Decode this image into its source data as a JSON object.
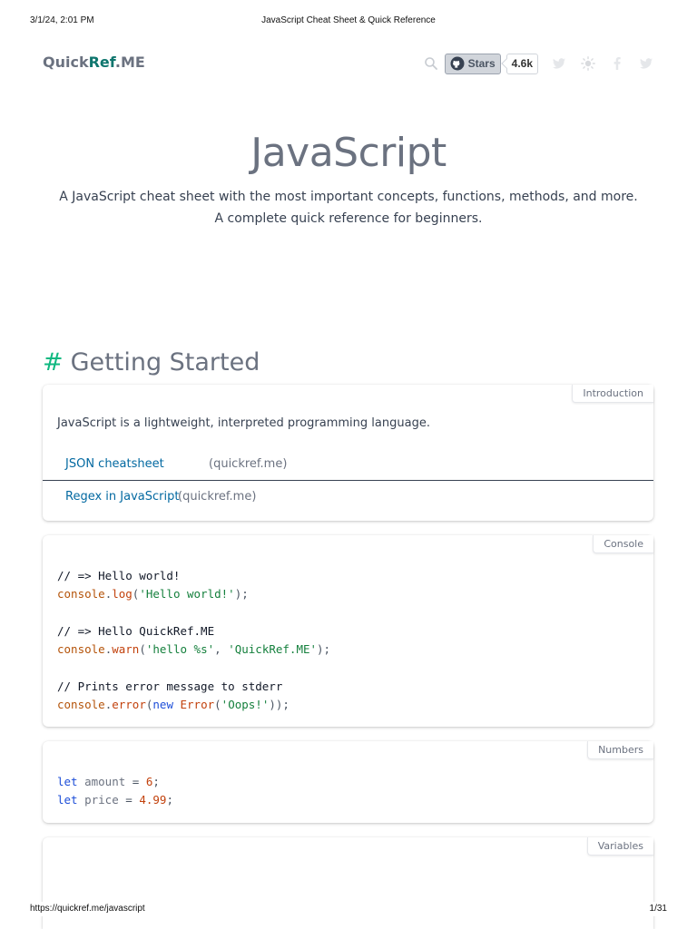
{
  "print_header": {
    "date": "3/1/24, 2:01 PM",
    "title": "JavaScript Cheat Sheet & Quick Reference"
  },
  "print_footer": {
    "url": "https://quickref.me/javascript",
    "page": "1/31"
  },
  "navbar": {
    "logo": {
      "quick": "Quick",
      "ref": "Ref",
      "me": ".ME"
    },
    "icons": [
      "search-icon",
      "github-icon",
      "twitter-icon",
      "sun-icon",
      "facebook-icon",
      "twitter-icon"
    ],
    "github_button_label": "Stars",
    "github_count": "4.6k"
  },
  "hero": {
    "title": "JavaScript",
    "description": "A JavaScript cheat sheet with the most important concepts, functions, methods, and more. A complete quick reference for beginners."
  },
  "section": {
    "hash": "#",
    "title": "Getting Started"
  },
  "cards": {
    "introduction": {
      "label": "Introduction",
      "text": "JavaScript is a lightweight, interpreted programming language.",
      "links": [
        {
          "text": "JSON cheatsheet",
          "source": "(quickref.me)"
        },
        {
          "text": "Regex in JavaScript",
          "source": "(quickref.me)"
        }
      ]
    },
    "console": {
      "label": "Console",
      "code": {
        "c1": "// => Hello world!",
        "obj": "console",
        "dot": ".",
        "log": "log",
        "paren_open": "(",
        "str_hello_world": "'Hello world!'",
        "close_semi": ");",
        "c2": "// => Hello QuickRef.ME",
        "warn": "warn",
        "str_hello_s": "'hello %s'",
        "comma": ", ",
        "str_quickref": "'QuickRef.ME'",
        "c3": "// Prints error message to stderr",
        "error": "error",
        "kw_new": "new",
        "space": " ",
        "cls_error": "Error",
        "str_oops": "'Oops!'",
        "close_close_semi": "));"
      }
    },
    "numbers": {
      "label": "Numbers",
      "code": {
        "kw_let": "let",
        "var_amount": "amount",
        "eq": " = ",
        "num_amount": "6",
        "semi": ";",
        "var_price": "price",
        "num_price": "4.99"
      }
    },
    "variables": {
      "label": "Variables"
    }
  }
}
